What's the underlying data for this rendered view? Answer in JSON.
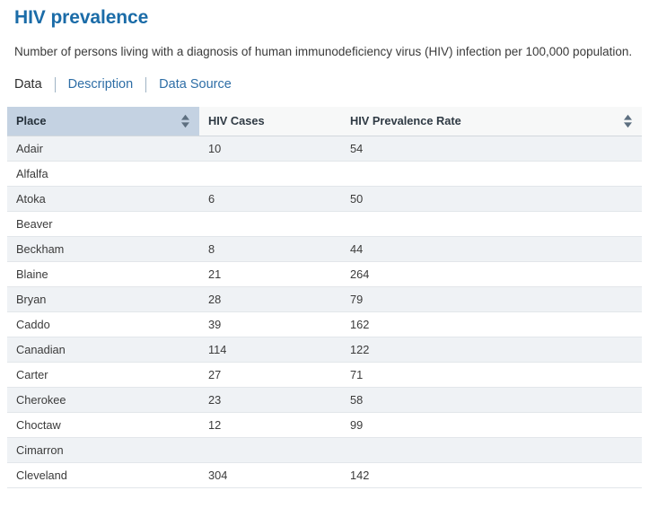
{
  "header": {
    "title": "HIV prevalence",
    "description": "Number of persons living with a diagnosis of human immunodeficiency virus (HIV) infection per 100,000 population."
  },
  "tabs": [
    {
      "label": "Data",
      "active": true
    },
    {
      "label": "Description",
      "active": false
    },
    {
      "label": "Data Source",
      "active": false
    }
  ],
  "table": {
    "columns": [
      {
        "label": "Place",
        "sorted": true,
        "sort_icon": "sort-updown-icon"
      },
      {
        "label": "HIV Cases",
        "sorted": false,
        "sort_icon": null
      },
      {
        "label": "HIV Prevalence Rate",
        "sorted": false,
        "sort_icon": "sort-updown-icon"
      }
    ],
    "rows": [
      {
        "place": "Adair",
        "cases": "10",
        "rate": "54"
      },
      {
        "place": "Alfalfa",
        "cases": "",
        "rate": ""
      },
      {
        "place": "Atoka",
        "cases": "6",
        "rate": "50"
      },
      {
        "place": "Beaver",
        "cases": "",
        "rate": ""
      },
      {
        "place": "Beckham",
        "cases": "8",
        "rate": "44"
      },
      {
        "place": "Blaine",
        "cases": "21",
        "rate": "264"
      },
      {
        "place": "Bryan",
        "cases": "28",
        "rate": "79"
      },
      {
        "place": "Caddo",
        "cases": "39",
        "rate": "162"
      },
      {
        "place": "Canadian",
        "cases": "114",
        "rate": "122"
      },
      {
        "place": "Carter",
        "cases": "27",
        "rate": "71"
      },
      {
        "place": "Cherokee",
        "cases": "23",
        "rate": "58"
      },
      {
        "place": "Choctaw",
        "cases": "12",
        "rate": "99"
      },
      {
        "place": "Cimarron",
        "cases": "",
        "rate": ""
      },
      {
        "place": "Cleveland",
        "cases": "304",
        "rate": "142"
      }
    ]
  },
  "colors": {
    "title": "#1b6ca8",
    "link": "#2e6ea6",
    "sorted_header_bg": "#c4d2e2",
    "header_bg": "#f7f8f8",
    "row_stripe_bg": "#eff2f5",
    "row_bg": "#ffffff"
  }
}
